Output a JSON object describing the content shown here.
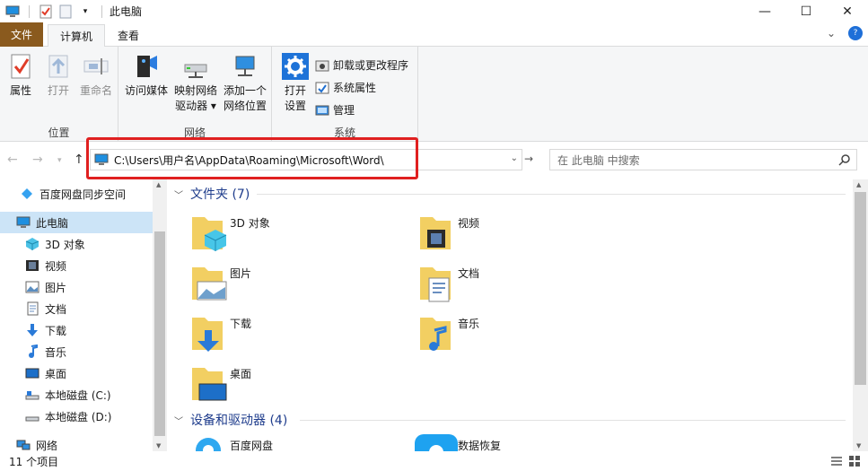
{
  "window": {
    "title": "此电脑",
    "minimize": "—",
    "maximize": "☐",
    "close": "✕"
  },
  "tabs": {
    "file": "文件",
    "computer": "计算机",
    "view": "查看",
    "expand_glyph": "⌄",
    "help_glyph": "?"
  },
  "ribbon": {
    "location_group": "位置",
    "network_group": "网络",
    "system_group": "系统",
    "properties": "属性",
    "open": "打开",
    "rename": "重命名",
    "access_media": "访问媒体",
    "map_drive_1": "映射网络",
    "map_drive_2": "驱动器",
    "add_location_1": "添加一个",
    "add_location_2": "网络位置",
    "open_settings_1": "打开",
    "open_settings_2": "设置",
    "uninstall": "卸载或更改程序",
    "system_properties": "系统属性",
    "manage": "管理"
  },
  "address": {
    "path": "C:\\Users\\用户名\\AppData\\Roaming\\Microsoft\\Word\\",
    "search_placeholder": "在 此电脑 中搜索"
  },
  "sidebar": {
    "items": [
      {
        "label": "百度网盘同步空间",
        "icon": "baidu-sync-icon"
      },
      {
        "label": "此电脑",
        "icon": "this-pc-icon"
      },
      {
        "label": "3D 对象",
        "icon": "3d-objects-icon"
      },
      {
        "label": "视频",
        "icon": "videos-icon"
      },
      {
        "label": "图片",
        "icon": "pictures-icon"
      },
      {
        "label": "文档",
        "icon": "documents-icon"
      },
      {
        "label": "下载",
        "icon": "downloads-icon"
      },
      {
        "label": "音乐",
        "icon": "music-icon"
      },
      {
        "label": "桌面",
        "icon": "desktop-icon"
      },
      {
        "label": "本地磁盘 (C:)",
        "icon": "drive-icon"
      },
      {
        "label": "本地磁盘 (D:)",
        "icon": "drive-icon"
      },
      {
        "label": "网络",
        "icon": "network-icon"
      }
    ]
  },
  "content": {
    "folders_header": "文件夹 (7)",
    "devices_header": "设备和驱动器 (4)",
    "folders": [
      {
        "label": "3D 对象",
        "icon": "3d-objects-folder-icon"
      },
      {
        "label": "视频",
        "icon": "videos-folder-icon"
      },
      {
        "label": "图片",
        "icon": "pictures-folder-icon"
      },
      {
        "label": "文档",
        "icon": "documents-folder-icon"
      },
      {
        "label": "下载",
        "icon": "downloads-folder-icon"
      },
      {
        "label": "音乐",
        "icon": "music-folder-icon"
      },
      {
        "label": "桌面",
        "icon": "desktop-folder-icon"
      }
    ],
    "devices": [
      {
        "label": "百度网盘",
        "icon": "baidu-netdisk-icon"
      },
      {
        "label": "数据恢复",
        "icon": "data-recovery-icon"
      }
    ]
  },
  "status": {
    "item_count": "11 个项目"
  },
  "colors": {
    "file_tab": "#8a5a1e",
    "selection": "#cce4f7",
    "highlight_box": "#e02020",
    "section_header": "#1e3c8c"
  }
}
